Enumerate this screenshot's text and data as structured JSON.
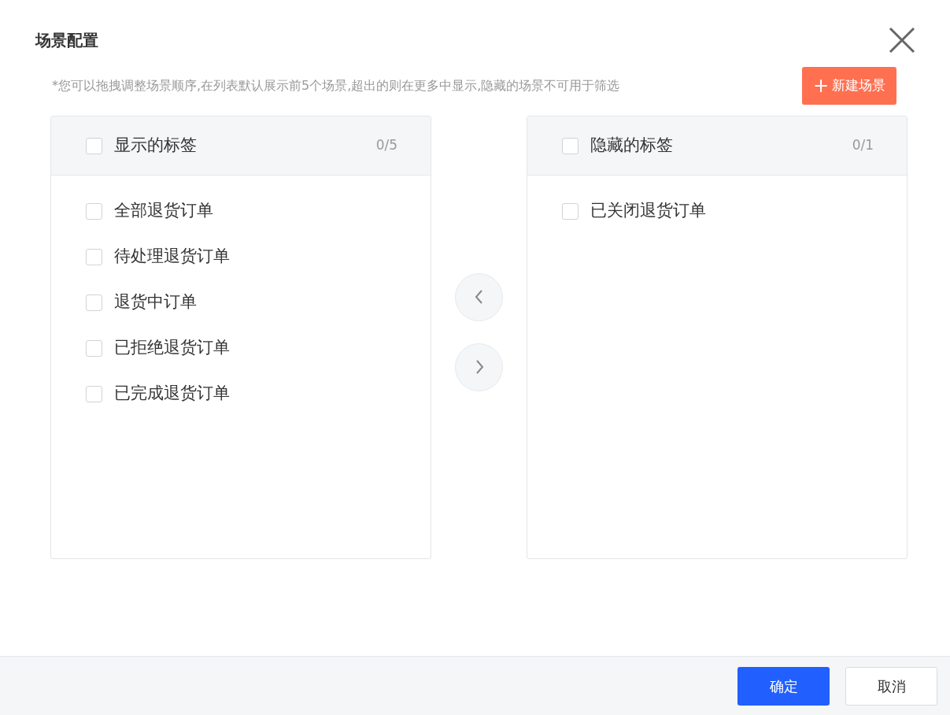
{
  "dialog": {
    "title": "场景配置"
  },
  "hint": "*您可以拖拽调整场景顺序,在列表默认展示前5个场景,超出的则在更多中显示,隐藏的场景不可用于筛选",
  "new_button": {
    "icon": "+",
    "label": "新建场景"
  },
  "panels": [
    {
      "title": "显示的标签",
      "count": "0/5",
      "checked": false,
      "items": [
        {
          "label": "全部退货订单",
          "checked": false
        },
        {
          "label": "待处理退货订单",
          "checked": false
        },
        {
          "label": "退货中订单",
          "checked": false
        },
        {
          "label": "已拒绝退货订单",
          "checked": false
        },
        {
          "label": "已完成退货订单",
          "checked": false
        }
      ]
    },
    {
      "title": "隐藏的标签",
      "count": "0/1",
      "checked": false,
      "items": [
        {
          "label": "已关闭退货订单",
          "checked": false
        }
      ]
    }
  ],
  "footer": {
    "buttons": [
      {
        "label": "确定",
        "kind": "primary"
      },
      {
        "label": "取消",
        "kind": "secondary"
      }
    ]
  }
}
